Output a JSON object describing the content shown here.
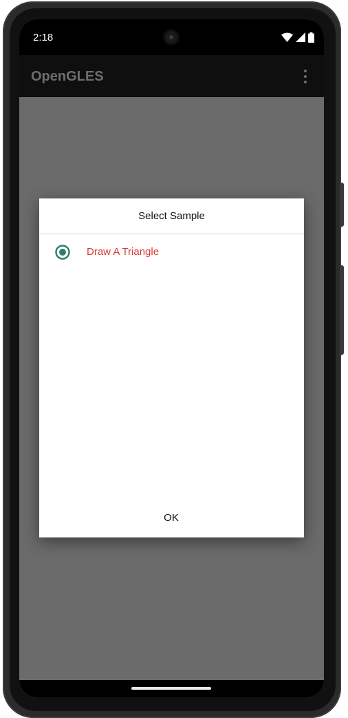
{
  "status_bar": {
    "time": "2:18",
    "icons": [
      "wifi-icon",
      "cellular-signal-icon",
      "battery-icon"
    ]
  },
  "app_bar": {
    "title": "OpenGLES",
    "overflow_icon": "more-vert-icon"
  },
  "dialog": {
    "title": "Select Sample",
    "options": [
      {
        "label": "Draw A Triangle",
        "selected": true
      }
    ],
    "ok_label": "OK"
  },
  "colors": {
    "radio_accent": "#2e7d6b",
    "option_text": "#d93b34",
    "scrim": "#6b6b6b",
    "app_bar": "#0f0f0f"
  }
}
